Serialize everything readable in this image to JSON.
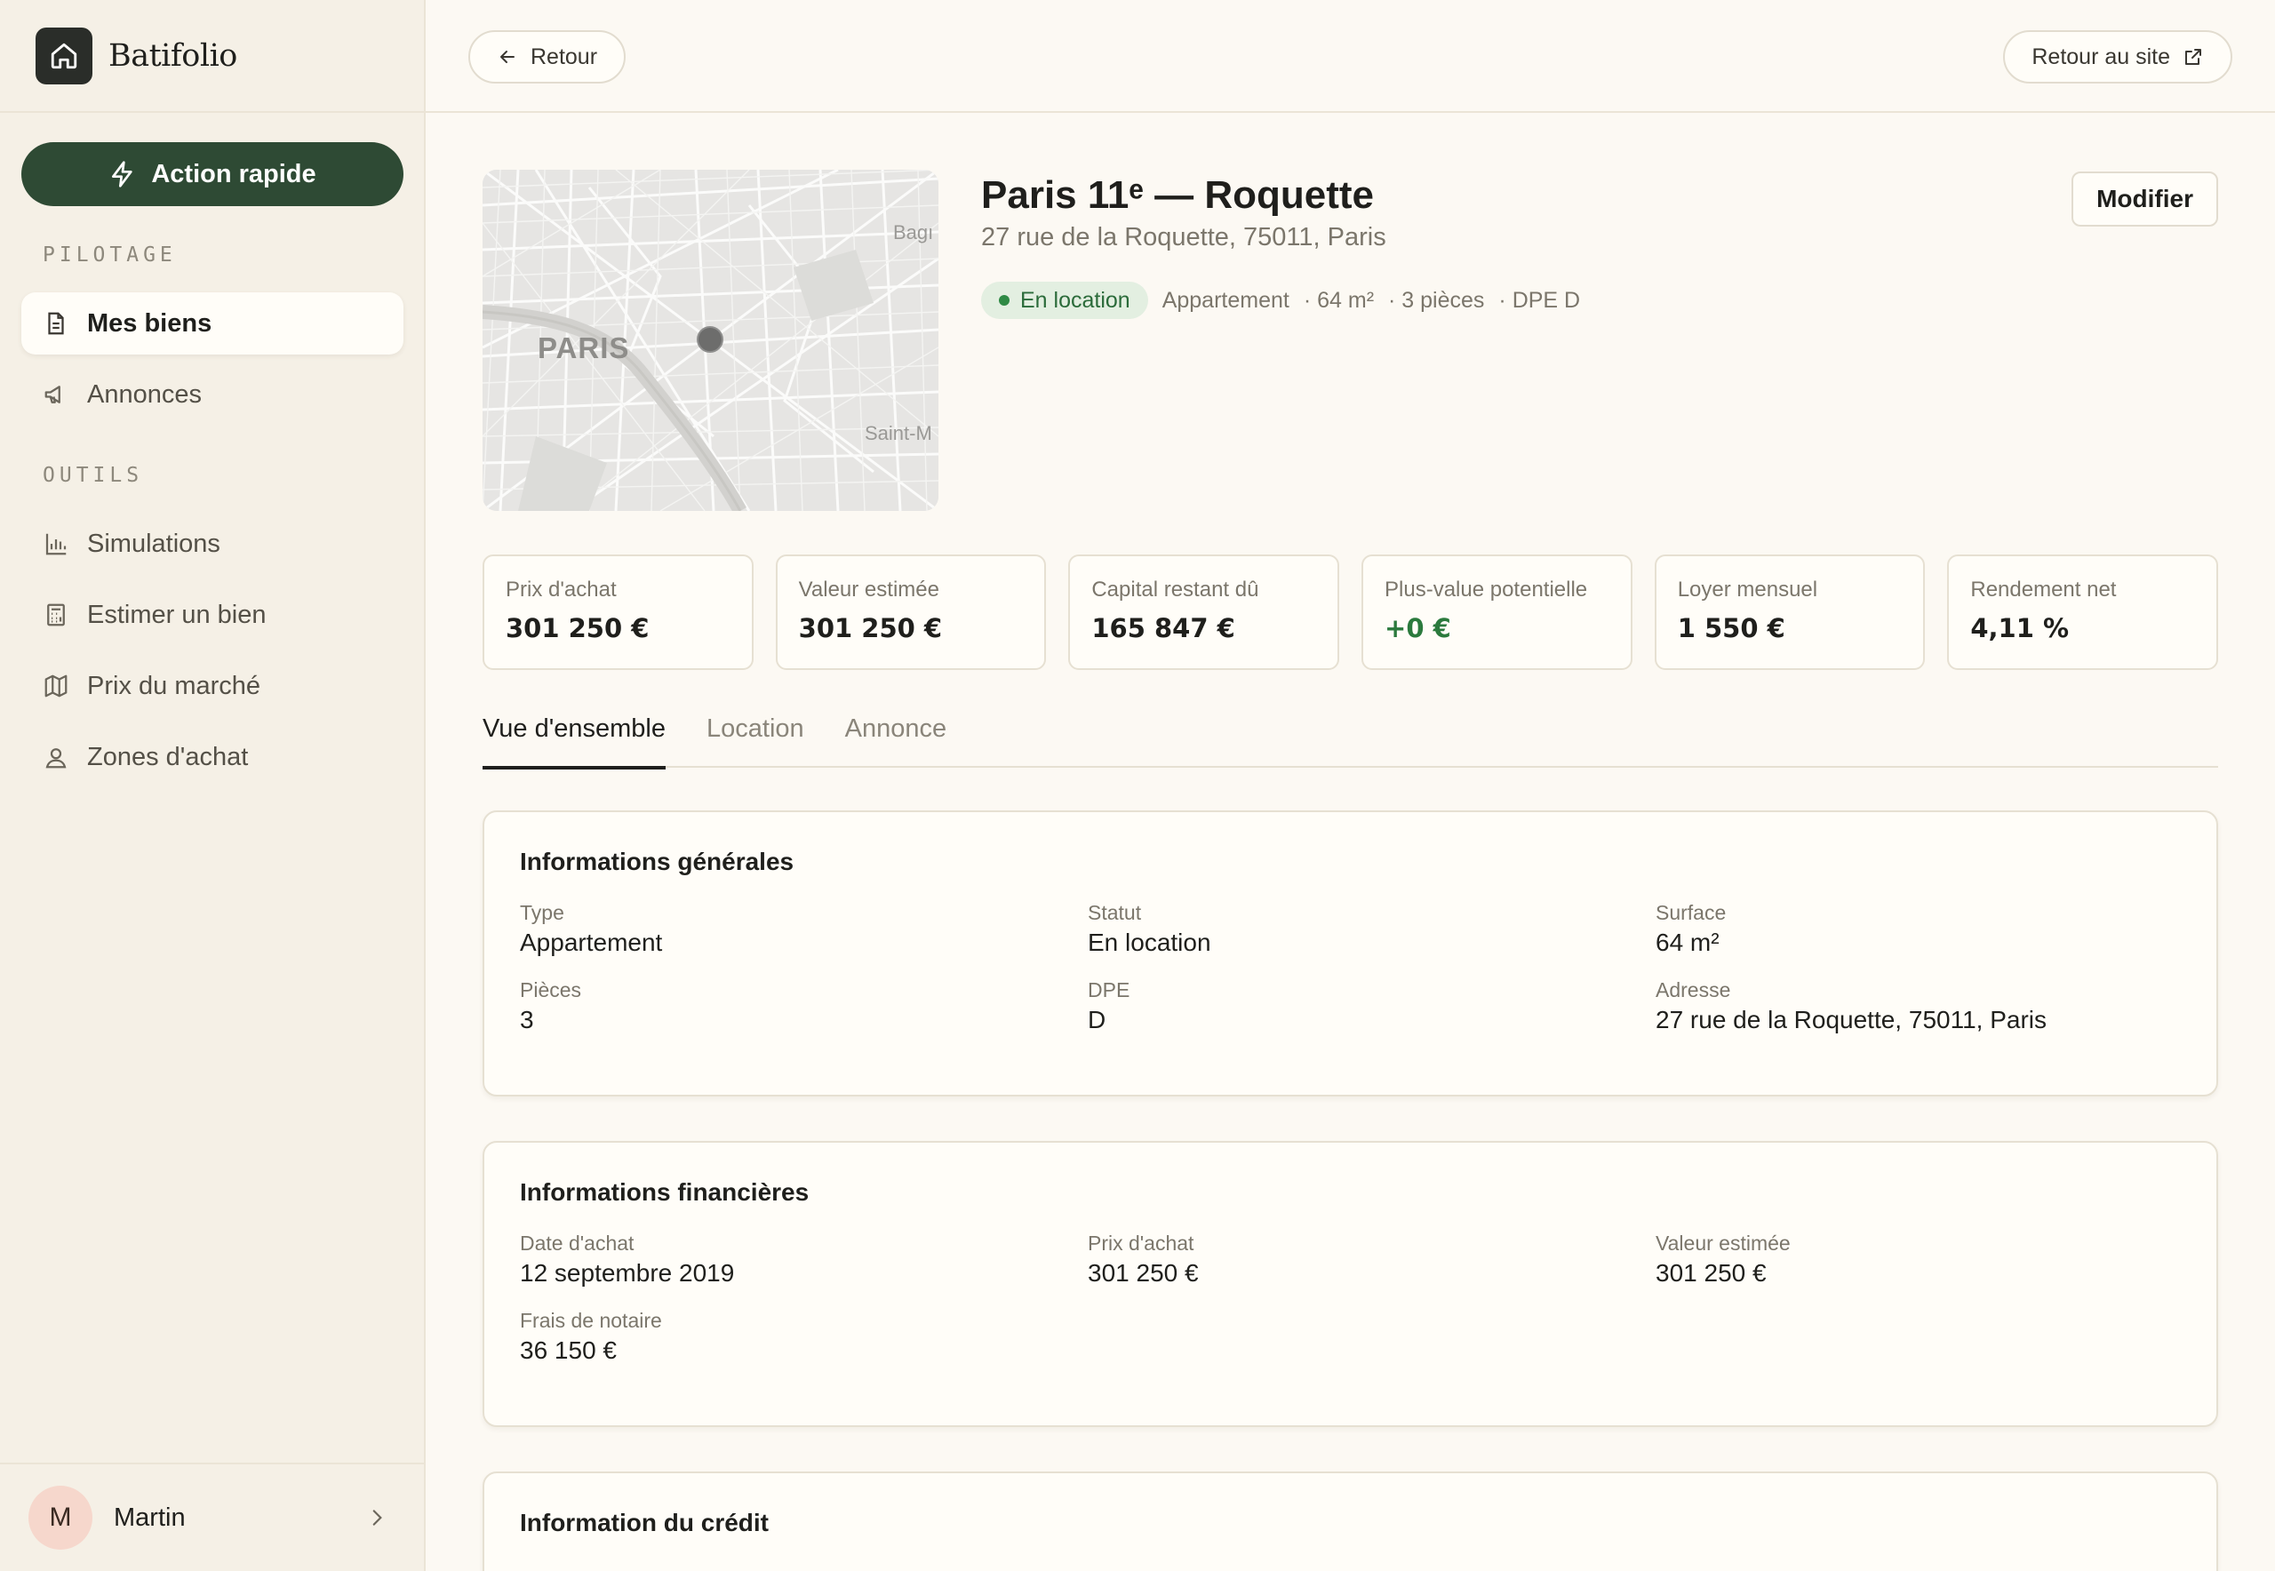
{
  "brand": {
    "name": "Batifolio"
  },
  "quick_action": {
    "label": "Action rapide"
  },
  "nav": {
    "section_pilotage": "PILOTAGE",
    "section_outils": "OUTILS",
    "items": [
      {
        "label": "Mes biens",
        "icon": "document-icon"
      },
      {
        "label": "Annonces",
        "icon": "megaphone-icon"
      },
      {
        "label": "Simulations",
        "icon": "bar-chart-icon"
      },
      {
        "label": "Estimer un bien",
        "icon": "calculator-icon"
      },
      {
        "label": "Prix du marché",
        "icon": "map-icon"
      },
      {
        "label": "Zones d'achat",
        "icon": "map-pin-icon"
      }
    ]
  },
  "user": {
    "initial": "M",
    "name": "Martin"
  },
  "topbar": {
    "back_label": "Retour",
    "site_label": "Retour au site"
  },
  "property": {
    "title": "Paris 11ᵉ — Roquette",
    "address": "27 rue de la Roquette, 75011, Paris",
    "status": "En location",
    "type": "Appartement",
    "surface": "· 64 m²",
    "rooms": "· 3 pièces",
    "dpe": "· DPE D",
    "edit_label": "Modifier",
    "map_labels": {
      "city": "PARIS",
      "top_right": "Bagı",
      "bottom_right": "Saint-M"
    }
  },
  "kpis": [
    {
      "label": "Prix d'achat",
      "value": "301 250 €"
    },
    {
      "label": "Valeur estimée",
      "value": "301 250 €"
    },
    {
      "label": "Capital restant dû",
      "value": "165 847 €"
    },
    {
      "label": "Plus-value potentielle",
      "value": "+0 €"
    },
    {
      "label": "Loyer mensuel",
      "value": "1 550 €"
    },
    {
      "label": "Rendement net",
      "value": "4,11 %"
    }
  ],
  "tabs": [
    "Vue d'ensemble",
    "Location",
    "Annonce"
  ],
  "general": {
    "title": "Informations générales",
    "fields": [
      {
        "label": "Type",
        "value": "Appartement"
      },
      {
        "label": "Statut",
        "value": "En location"
      },
      {
        "label": "Surface",
        "value": "64 m²"
      },
      {
        "label": "Pièces",
        "value": "3"
      },
      {
        "label": "DPE",
        "value": "D"
      },
      {
        "label": "Adresse",
        "value": "27 rue de la Roquette, 75011, Paris"
      }
    ]
  },
  "financial": {
    "title": "Informations financières",
    "fields": [
      {
        "label": "Date d'achat",
        "value": "12 septembre 2019"
      },
      {
        "label": "Prix d'achat",
        "value": "301 250 €"
      },
      {
        "label": "Valeur estimée",
        "value": "301 250 €"
      },
      {
        "label": "Frais de notaire",
        "value": "36 150 €"
      }
    ]
  },
  "credit": {
    "title": "Information du crédit"
  },
  "colors": {
    "accent": "#2e4a34",
    "positive": "#2b7a3d",
    "background": "#fcf9f3",
    "sidebar": "#f5f0e6"
  }
}
